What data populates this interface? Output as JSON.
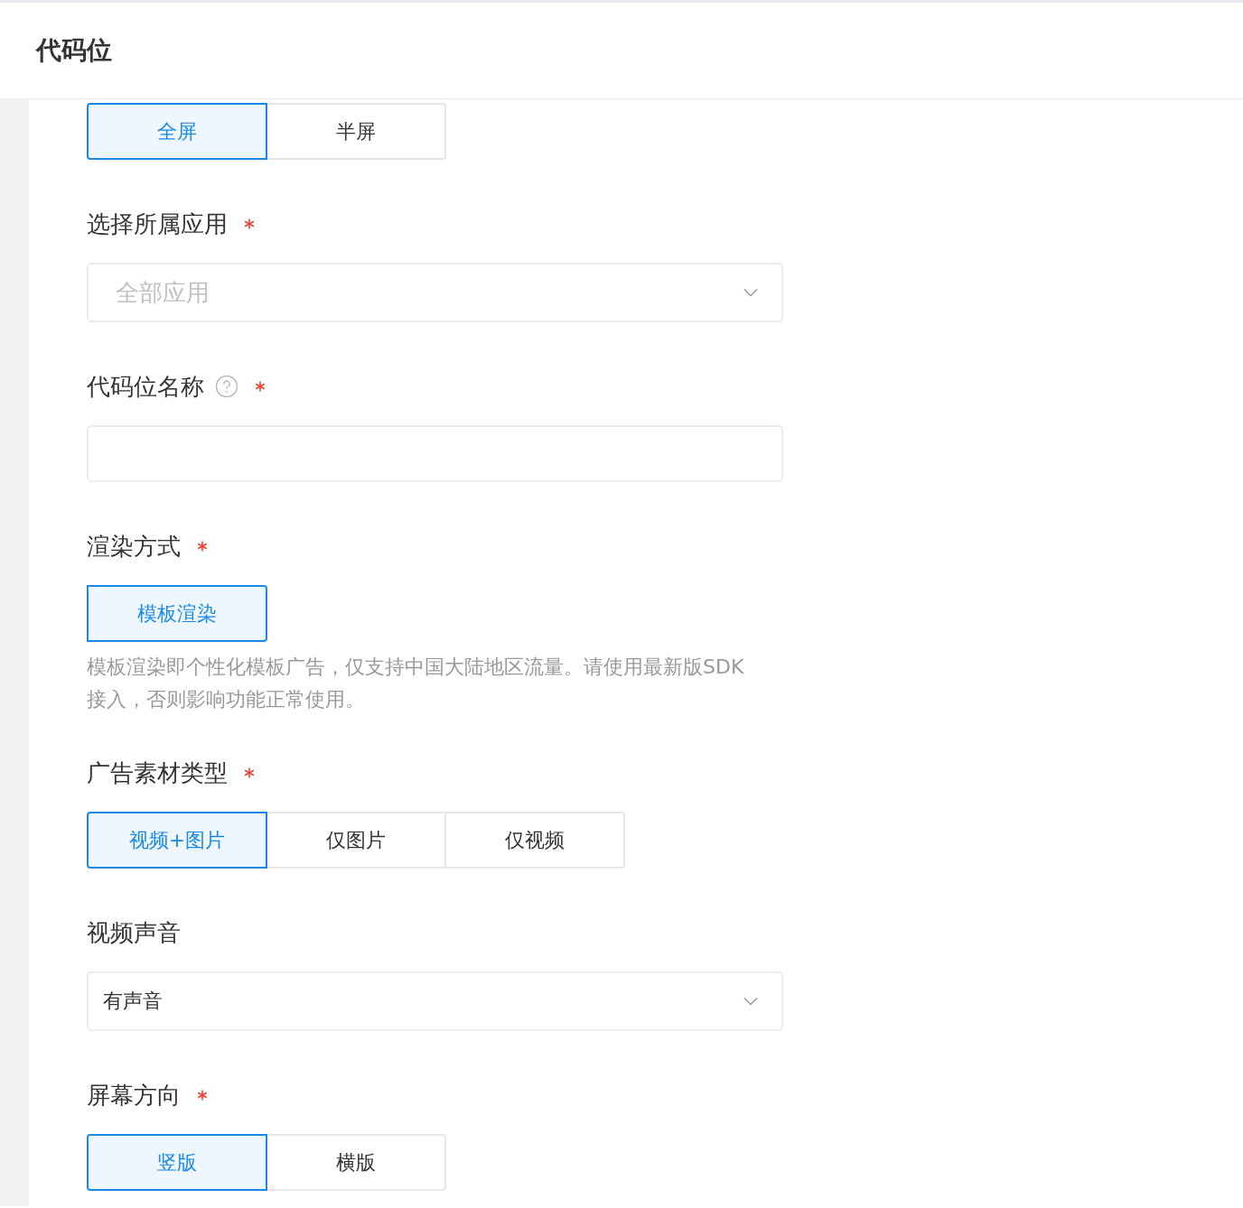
{
  "header": {
    "title": "代码位"
  },
  "fields": [
    {
      "kind": "segmented",
      "options": [
        {
          "label": "全屏",
          "selected": true
        },
        {
          "label": "半屏",
          "selected": false
        }
      ]
    },
    {
      "kind": "select",
      "label": "选择所属应用",
      "required": true,
      "help": false,
      "placeholder": "全部应用"
    },
    {
      "kind": "input",
      "label": "代码位名称",
      "required": true,
      "help": true
    },
    {
      "kind": "segmented",
      "label": "渲染方式",
      "required": true,
      "help": false,
      "options": [
        {
          "label": "模板渲染",
          "selected": true
        }
      ],
      "hint": "模板渲染即个性化模板广告，仅支持中国大陆地区流量。请使用最新版SDK接入，否则影响功能正常使用。"
    },
    {
      "kind": "segmented",
      "label": "广告素材类型",
      "required": true,
      "help": false,
      "options": [
        {
          "label": "视频+图片",
          "selected": true
        },
        {
          "label": "仅图片",
          "selected": false
        },
        {
          "label": "仅视频",
          "selected": false
        }
      ]
    },
    {
      "kind": "select",
      "label": "视频声音",
      "required": false,
      "help": false,
      "value": "有声音"
    },
    {
      "kind": "segmented",
      "label": "屏幕方向",
      "required": true,
      "help": false,
      "options": [
        {
          "label": "竖版",
          "selected": true
        },
        {
          "label": "横版",
          "selected": false
        }
      ]
    }
  ]
}
